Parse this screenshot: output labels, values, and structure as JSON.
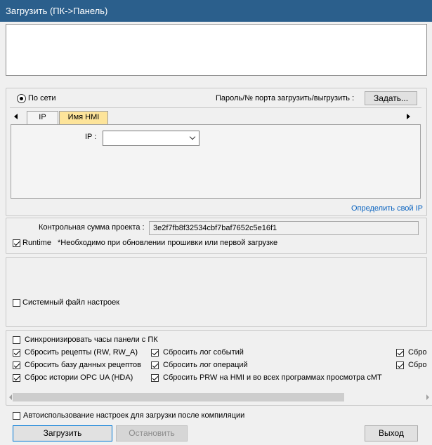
{
  "window": {
    "title": "Загрузить (ПК->Панель)"
  },
  "connection": {
    "radio_label": "По сети",
    "password_label": "Пароль/№ порта загрузить/выгрузить :",
    "set_button": "Задать..."
  },
  "tabs": [
    {
      "label": "IP"
    },
    {
      "label": "Имя HMI"
    }
  ],
  "ip": {
    "label": "IP :",
    "value": ""
  },
  "detect_ip_link": "Определить свой IP",
  "checksum": {
    "label": "Контрольная сумма проекта :",
    "value": "3e2f7fb8f32534cbf7baf7652c5e16f1"
  },
  "runtime": {
    "label": "Runtime",
    "checked": true,
    "note": "*Необходимо при обновлении прошивки или первой загрузке"
  },
  "system_settings": {
    "label": "Системный файл настроек",
    "checked": false
  },
  "options": {
    "sync_clock": {
      "label": "Синхронизировать часы панели с ПК",
      "checked": false
    },
    "reset_recipes": {
      "label": "Сбросить рецепты (RW, RW_A)",
      "checked": true
    },
    "reset_event_log": {
      "label": "Сбросить лог событий",
      "checked": true
    },
    "reset_col3_a": {
      "label": "Сбро",
      "checked": true
    },
    "reset_recipe_db": {
      "label": "Сбросить базу данных рецептов",
      "checked": true
    },
    "reset_op_log": {
      "label": "Сбросить лог операций",
      "checked": true
    },
    "reset_col3_b": {
      "label": "Сбро",
      "checked": true
    },
    "reset_opc_history": {
      "label": "Сброс истории OPC UA (HDA)",
      "checked": true
    },
    "reset_prw": {
      "label": "Сбросить PRW на HMI и во всех программах просмотра cMT",
      "checked": true
    }
  },
  "auto_use": {
    "label": "Автоиспользование настроек для загрузки после компиляции",
    "checked": false
  },
  "buttons": {
    "download": "Загрузить",
    "stop": "Остановить",
    "exit": "Выход"
  }
}
